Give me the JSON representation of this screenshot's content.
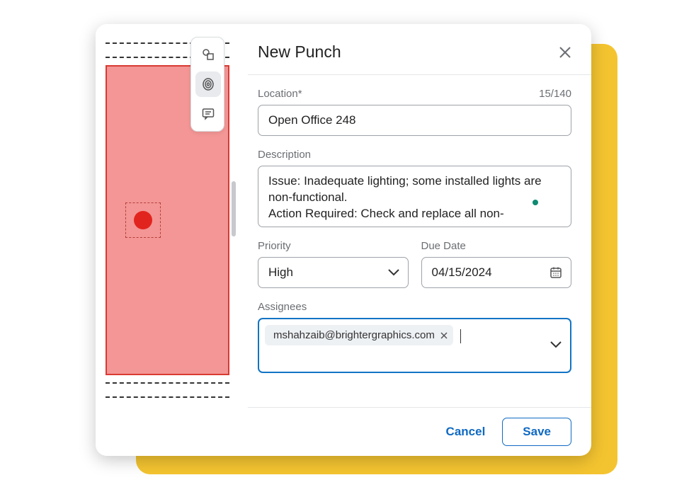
{
  "panel": {
    "title": "New Punch"
  },
  "location": {
    "label": "Location*",
    "counter": "15/140",
    "value": "Open Office 248"
  },
  "description": {
    "label": "Description",
    "value": "Issue: Inadequate lighting; some installed lights are non-functional.\nAction Required: Check and replace all non-"
  },
  "priority": {
    "label": "Priority",
    "value": "High"
  },
  "dueDate": {
    "label": "Due Date",
    "value": "04/15/2024"
  },
  "assignees": {
    "label": "Assignees",
    "chips": [
      "mshahzaib@brightergraphics.com"
    ]
  },
  "footer": {
    "cancel": "Cancel",
    "save": "Save"
  }
}
